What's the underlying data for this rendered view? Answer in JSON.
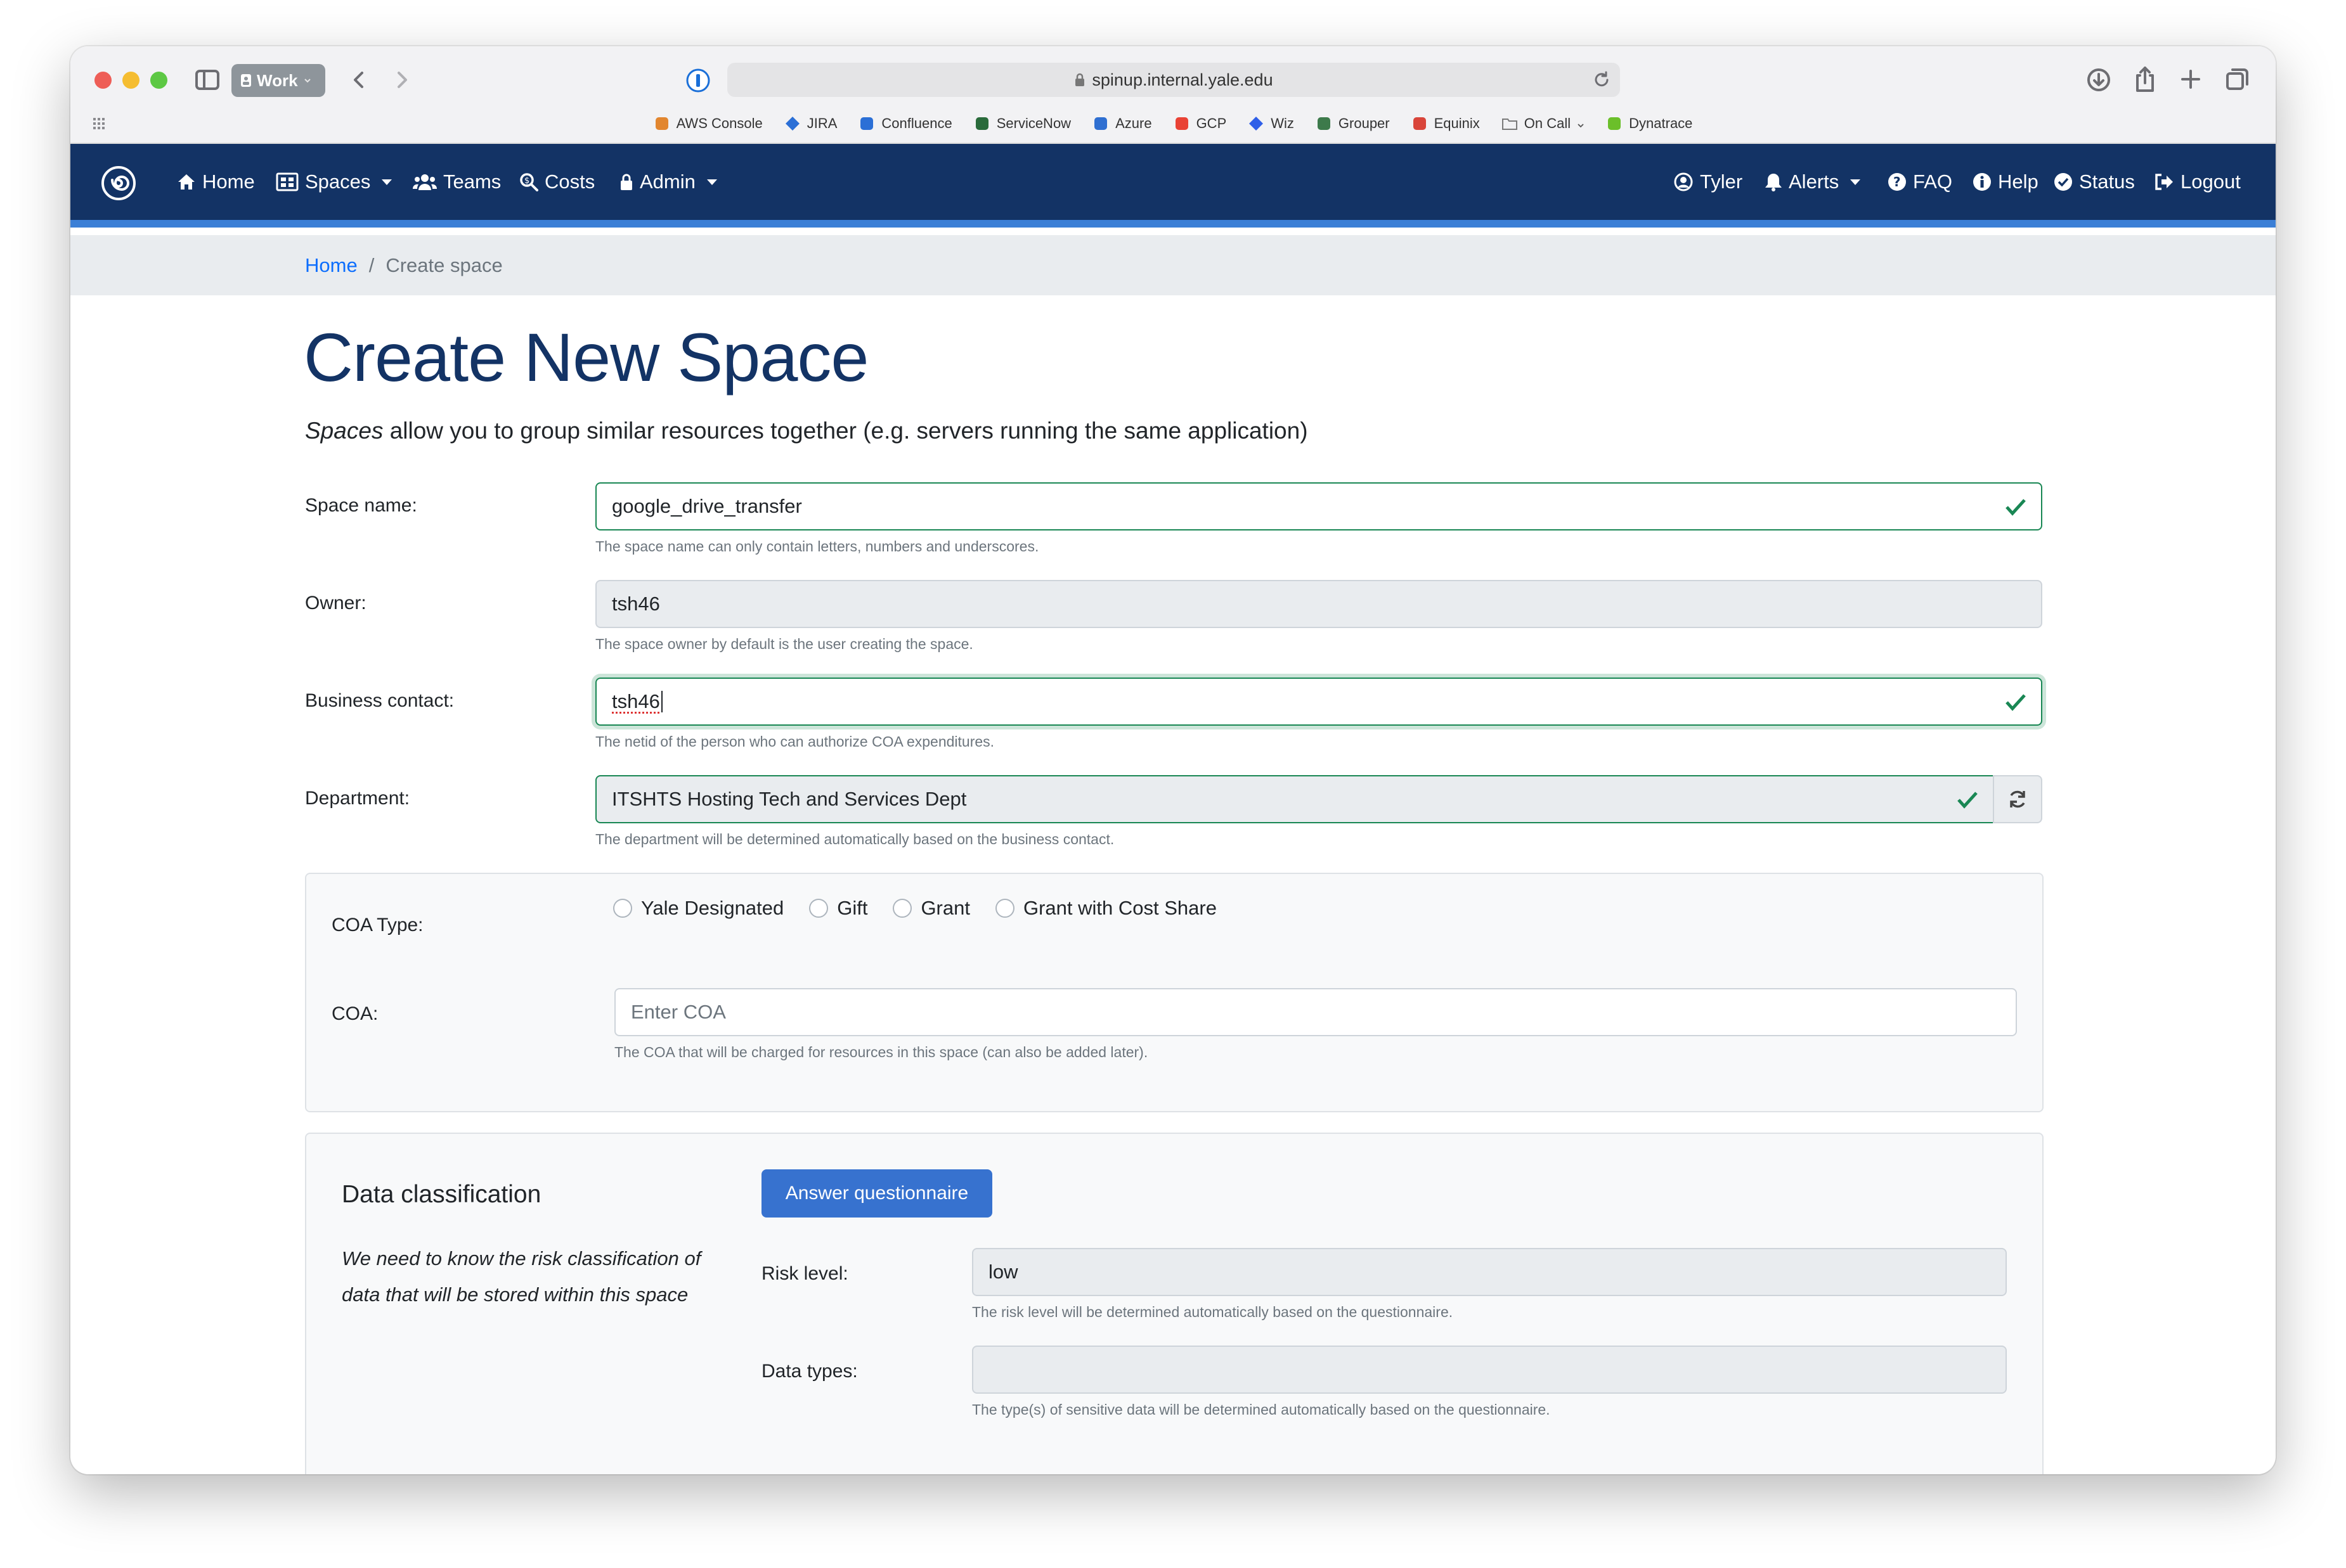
{
  "browser": {
    "profile": "Work",
    "url": "spinup.internal.yale.edu",
    "bookmarks": [
      {
        "label": "AWS Console",
        "icon": "aws-icon",
        "color": "#e2862f"
      },
      {
        "label": "JIRA",
        "icon": "jira-icon",
        "color": "#2b6fd6"
      },
      {
        "label": "Confluence",
        "icon": "confluence-icon",
        "color": "#2b6fd6"
      },
      {
        "label": "ServiceNow",
        "icon": "servicenow-icon",
        "color": "#2a6b3b"
      },
      {
        "label": "Azure",
        "icon": "azure-icon",
        "color": "#2f6fd1"
      },
      {
        "label": "GCP",
        "icon": "gcp-icon",
        "color": "#e94235"
      },
      {
        "label": "Wiz",
        "icon": "wiz-icon",
        "color": "#2f5fe8"
      },
      {
        "label": "Grouper",
        "icon": "grouper-icon",
        "color": "#3d7a4b"
      },
      {
        "label": "Equinix",
        "icon": "equinix-icon",
        "color": "#d9453a"
      },
      {
        "label": "On Call",
        "icon": "folder-icon",
        "color": "#7a7a7a"
      },
      {
        "label": "Dynatrace",
        "icon": "dynatrace-icon",
        "color": "#6bbf2a"
      }
    ]
  },
  "nav": {
    "left": [
      {
        "label": "Home",
        "icon": "home-icon"
      },
      {
        "label": "Spaces",
        "icon": "spaces-icon",
        "dropdown": true
      },
      {
        "label": "Teams",
        "icon": "users-icon"
      },
      {
        "label": "Costs",
        "icon": "search-dollar-icon"
      },
      {
        "label": "Admin",
        "icon": "lock-icon",
        "dropdown": true
      }
    ],
    "right": [
      {
        "label": "Tyler",
        "icon": "user-circle-icon"
      },
      {
        "label": "Alerts",
        "icon": "bell-icon",
        "dropdown": true
      },
      {
        "label": "FAQ",
        "icon": "question-circle-icon"
      },
      {
        "label": "Help",
        "icon": "info-circle-icon"
      },
      {
        "label": "Status",
        "icon": "check-circle-icon"
      },
      {
        "label": "Logout",
        "icon": "logout-icon"
      }
    ]
  },
  "breadcrumb": {
    "home": "Home",
    "separator": "/",
    "current": "Create space"
  },
  "page": {
    "title": "Create New Space",
    "lead_em": "Spaces",
    "lead_rest": " allow you to group similar resources together (e.g. servers running the same application)"
  },
  "form": {
    "space_name": {
      "label": "Space name:",
      "value": "google_drive_transfer",
      "help": "The space name can only contain letters, numbers and underscores."
    },
    "owner": {
      "label": "Owner:",
      "value": "tsh46",
      "help": "The space owner by default is the user creating the space."
    },
    "business_contact": {
      "label": "Business contact:",
      "value": "tsh46",
      "help": "The netid of the person who can authorize COA expenditures."
    },
    "department": {
      "label": "Department:",
      "value": "ITSHTS Hosting Tech and Services Dept",
      "help": "The department will be determined automatically based on the business contact."
    },
    "coa_type": {
      "label": "COA Type:",
      "options": [
        "Yale Designated",
        "Gift",
        "Grant",
        "Grant with Cost Share"
      ]
    },
    "coa": {
      "label": "COA:",
      "placeholder": "Enter COA",
      "help": "The COA that will be charged for resources in this space (can also be added later)."
    }
  },
  "data_classification": {
    "heading": "Data classification",
    "description": "We need to know the risk classification of data that will be stored within this space",
    "button": "Answer questionnaire",
    "risk_level": {
      "label": "Risk level:",
      "value": "low",
      "help": "The risk level will be determined automatically based on the questionnaire."
    },
    "data_types": {
      "label": "Data types:",
      "value": "",
      "help": "The type(s) of sensitive data will be determined automatically based on the questionnaire."
    }
  },
  "colors": {
    "navbar": "#133365",
    "accent": "#3b7fd6",
    "valid": "#198754",
    "button": "#3772cf"
  }
}
